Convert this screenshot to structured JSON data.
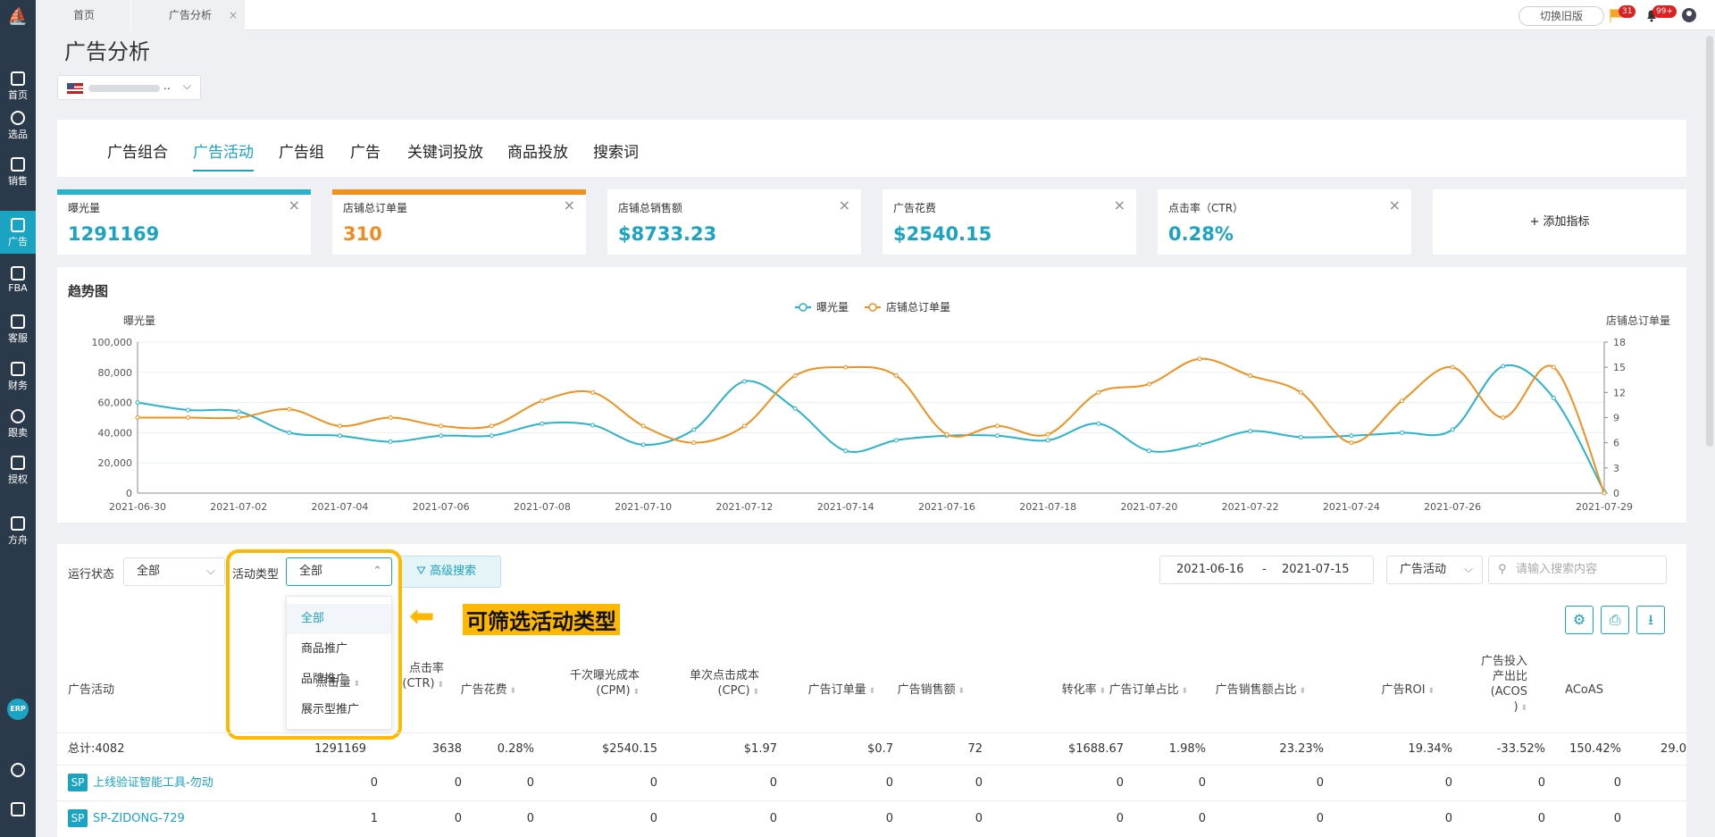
{
  "sidebar": {
    "items": [
      {
        "label": "首页"
      },
      {
        "label": "选品"
      },
      {
        "label": "销售"
      },
      {
        "label": "广告"
      },
      {
        "label": "FBA"
      },
      {
        "label": "客服"
      },
      {
        "label": "财务"
      },
      {
        "label": "跟卖"
      },
      {
        "label": "授权"
      },
      {
        "label": "方舟"
      }
    ],
    "erp": "ERP"
  },
  "topbar": {
    "tab_home": "首页",
    "tab_ad": "广告分析",
    "close": "×",
    "switch_old": "切换旧版",
    "flag_badge": "31",
    "bell_badge": "99+"
  },
  "page": {
    "title": "广告分析",
    "store_suffix": ".."
  },
  "tabs": [
    "广告组合",
    "广告活动",
    "广告组",
    "广告",
    "关键词投放",
    "商品投放",
    "搜索词"
  ],
  "cards": [
    {
      "label": "曝光量",
      "value": "1291169",
      "color": "#1ba3c2"
    },
    {
      "label": "店铺总订单量",
      "value": "310",
      "color": "#f08c1e"
    },
    {
      "label": "店铺总销售额",
      "value": "$8733.23",
      "color": "#1ba3c2"
    },
    {
      "label": "广告花费",
      "value": "$2540.15",
      "color": "#1ba3c2"
    },
    {
      "label": "点击率（CTR）",
      "value": "0.28%",
      "color": "#1ba3c2"
    }
  ],
  "add_metric": "+ 添加指标",
  "chart_data": {
    "type": "line",
    "title": "趋势图",
    "ylabel_left": "曝光量",
    "ylabel_right": "店铺总订单量",
    "ylim_left": [
      0,
      100000
    ],
    "ylim_right": [
      0,
      18
    ],
    "yticks_left": [
      "100,000",
      "80,000",
      "60,000",
      "40,000",
      "20,000",
      "0"
    ],
    "yticks_right": [
      "18",
      "15",
      "12",
      "9",
      "6",
      "3",
      "0"
    ],
    "xticks": [
      "2021-06-30",
      "2021-07-02",
      "2021-07-04",
      "2021-07-06",
      "2021-07-08",
      "2021-07-10",
      "2021-07-12",
      "2021-07-14",
      "2021-07-16",
      "2021-07-18",
      "2021-07-20",
      "2021-07-22",
      "2021-07-24",
      "2021-07-26",
      "2021-07-29"
    ],
    "x": [
      "2021-06-30",
      "2021-07-01",
      "2021-07-02",
      "2021-07-03",
      "2021-07-04",
      "2021-07-05",
      "2021-07-06",
      "2021-07-07",
      "2021-07-08",
      "2021-07-09",
      "2021-07-10",
      "2021-07-11",
      "2021-07-12",
      "2021-07-13",
      "2021-07-14",
      "2021-07-15",
      "2021-07-16",
      "2021-07-17",
      "2021-07-18",
      "2021-07-19",
      "2021-07-20",
      "2021-07-21",
      "2021-07-22",
      "2021-07-23",
      "2021-07-24",
      "2021-07-25",
      "2021-07-26",
      "2021-07-27",
      "2021-07-28",
      "2021-07-29"
    ],
    "series": [
      {
        "name": "曝光量",
        "axis": "left",
        "color": "#2bb3c9",
        "values": [
          60000,
          55000,
          54000,
          40000,
          38000,
          34000,
          38000,
          38000,
          46000,
          45000,
          32000,
          42000,
          74000,
          56000,
          28000,
          35000,
          38000,
          38000,
          35000,
          46000,
          28000,
          32000,
          41000,
          37000,
          38000,
          40000,
          42000,
          84000,
          63000,
          1000
        ]
      },
      {
        "name": "店铺总订单量",
        "axis": "right",
        "color": "#f0901e",
        "values": [
          9,
          9,
          9,
          10,
          8,
          9,
          8,
          8,
          11,
          12,
          8,
          6,
          8,
          14,
          15,
          14,
          7,
          8,
          7,
          12,
          13,
          16,
          14,
          12,
          6,
          11,
          15,
          9,
          15,
          0
        ]
      }
    ]
  },
  "filters": {
    "status_label": "运行状态",
    "status_value": "全部",
    "type_label": "活动类型",
    "type_value": "全部",
    "adv_search": "高级搜索",
    "date_from": "2021-06-16",
    "date_sep": "-",
    "date_to": "2021-07-15",
    "scope": "广告活动",
    "search_placeholder": "请输入搜索内容"
  },
  "dropdown": [
    "全部",
    "商品推广",
    "品牌推广",
    "展示型推广"
  ],
  "annotation": "可筛选活动类型",
  "table": {
    "headers": [
      "广告活动",
      "点击量",
      "点击率\n(CTR)",
      "广告花费",
      "千次曝光成本\n(CPM)",
      "单次点击成本\n(CPC)",
      "广告订单量",
      "广告销售额",
      "转化率",
      "广告订单占比",
      "广告销售额占比",
      "广告ROI",
      "广告投入\n产出比\n(ACOS\n)",
      "ACoAS"
    ],
    "total": [
      "总计:4082",
      "1291169",
      "3638",
      "0.28%",
      "$2540.15",
      "$1.97",
      "$0.7",
      "72",
      "$1688.67",
      "1.98%",
      "23.23%",
      "19.34%",
      "-33.52%",
      "150.42%",
      "29.0"
    ],
    "rows": [
      {
        "type": "SP",
        "name": "上线验证智能工具-勿动",
        "cells": [
          "0",
          "0",
          "0",
          "0",
          "0",
          "0",
          "0",
          "0",
          "0",
          "0",
          "0",
          "0",
          "0"
        ]
      },
      {
        "type": "SP",
        "name": "SP-ZIDONG-729",
        "cells": [
          "1",
          "0",
          "0",
          "0",
          "0",
          "0",
          "0",
          "0",
          "0",
          "0",
          "0",
          "0",
          "0"
        ]
      }
    ]
  }
}
